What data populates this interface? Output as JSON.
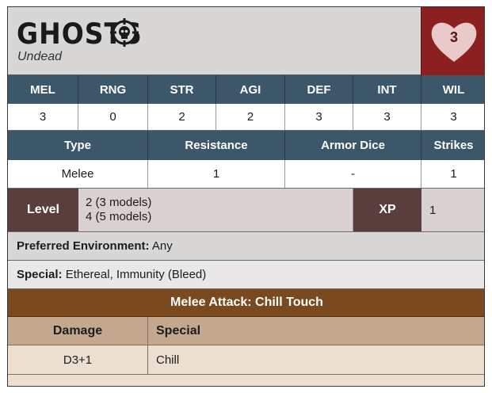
{
  "card": {
    "title": "GHOSTS",
    "subtitle": "Undead",
    "health": "3",
    "icons": {
      "title_icon": "skull-target-icon",
      "health_icon": "heart-icon"
    },
    "colors": {
      "header": "#3c566a",
      "health_bg": "#8c2020",
      "attack_bar": "#7a4a1e",
      "damage_header": "#c3a88f"
    }
  },
  "stats": {
    "headers": [
      "MEL",
      "RNG",
      "STR",
      "AGI",
      "DEF",
      "INT",
      "WIL"
    ],
    "values": [
      "3",
      "0",
      "2",
      "2",
      "3",
      "3",
      "3"
    ]
  },
  "combat": {
    "headers": [
      "Type",
      "Resistance",
      "Armor Dice",
      "Strikes"
    ],
    "values": [
      "Melee",
      "1",
      "-",
      "1"
    ]
  },
  "level": {
    "label": "Level",
    "line1": "2 (3 models)",
    "line2": "4 (5 models)",
    "xp_label": "XP",
    "xp_value": "1"
  },
  "preferred": {
    "label": "Preferred Environment:",
    "value": " Any"
  },
  "special": {
    "label": "Special:",
    "value": " Ethereal, Immunity (Bleed)"
  },
  "attack": {
    "title": "Melee Attack: Chill Touch",
    "damage_label": "Damage",
    "special_label": "Special",
    "damage_value": "D3+1",
    "special_value": "Chill"
  }
}
